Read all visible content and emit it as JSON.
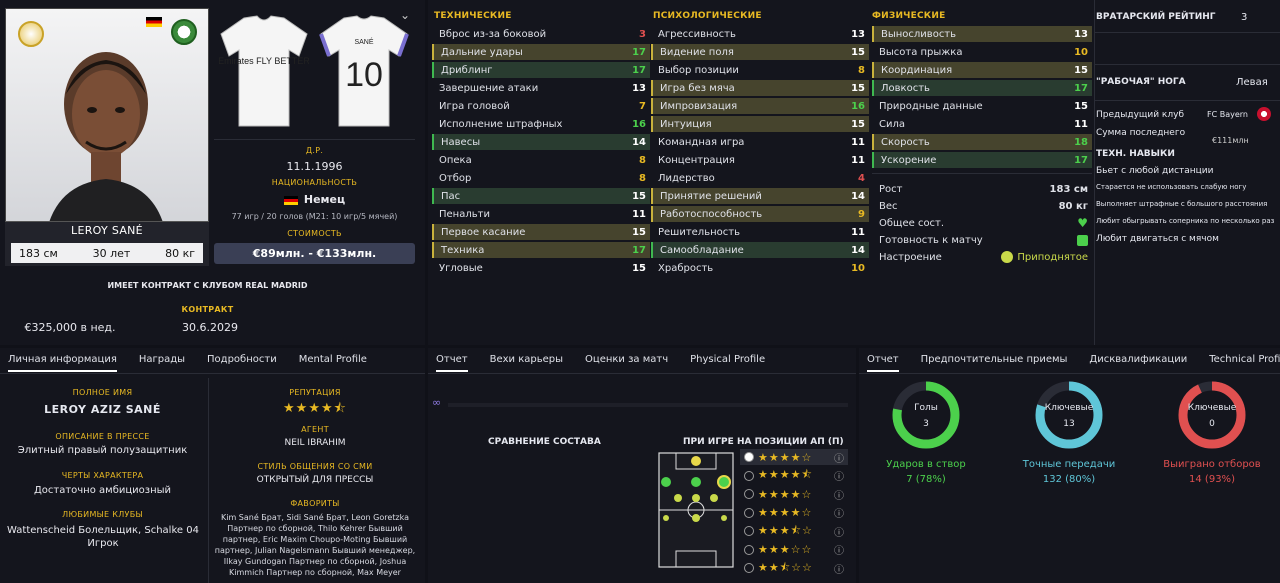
{
  "profile": {
    "name": "LEROY SANÉ",
    "height": "183 см",
    "age": "30 лет",
    "weight": "80 кг",
    "kit_back_name": "SANÉ",
    "kit_back_number": "10",
    "kit_front_text": "Emirates FLY BETTER",
    "dob_label": "Д.Р.",
    "dob": "11.1.1996",
    "nationality_label": "НАЦИОНАЛЬНОСТЬ",
    "nationality": "Немец",
    "caps": "77 игр / 20 голов (М21: 10 игр/5 мячей)",
    "value_label": "СТОИМОСТЬ",
    "value": "€89млн. - €133млн.",
    "contract_text": "ИМЕЕТ КОНТРАКТ С КЛУБОМ REAL MADRID",
    "contract_label": "КОНТРАКТ",
    "wage": "€325,000 в нед.",
    "contract_end": "30.6.2029"
  },
  "attributes": {
    "technical_title": "ТЕХНИЧЕСКИЕ",
    "mental_title": "ПСИХОЛОГИЧЕСКИЕ",
    "physical_title": "ФИЗИЧЕСКИЕ",
    "technical": [
      {
        "label": "Вброс из-за боковой",
        "value": "3",
        "hl": "",
        "color": "#e05050"
      },
      {
        "label": "Дальние удары",
        "value": "17",
        "hl": "y",
        "color": "#4cd04c"
      },
      {
        "label": "Дриблинг",
        "value": "17",
        "hl": "g",
        "color": "#4cd04c"
      },
      {
        "label": "Завершение атаки",
        "value": "13",
        "hl": "",
        "color": "#ffffff"
      },
      {
        "label": "Игра головой",
        "value": "7",
        "hl": "",
        "color": "#e8b923"
      },
      {
        "label": "Исполнение штрафных",
        "value": "16",
        "hl": "",
        "color": "#4cd04c"
      },
      {
        "label": "Навесы",
        "value": "14",
        "hl": "g",
        "color": "#ffffff"
      },
      {
        "label": "Опека",
        "value": "8",
        "hl": "",
        "color": "#e8b923"
      },
      {
        "label": "Отбор",
        "value": "8",
        "hl": "",
        "color": "#e8b923"
      },
      {
        "label": "Пас",
        "value": "15",
        "hl": "g",
        "color": "#ffffff"
      },
      {
        "label": "Пенальти",
        "value": "11",
        "hl": "",
        "color": "#ffffff"
      },
      {
        "label": "Первое касание",
        "value": "15",
        "hl": "y",
        "color": "#ffffff"
      },
      {
        "label": "Техника",
        "value": "17",
        "hl": "y",
        "color": "#4cd04c"
      },
      {
        "label": "Угловые",
        "value": "15",
        "hl": "",
        "color": "#ffffff"
      }
    ],
    "mental": [
      {
        "label": "Агрессивность",
        "value": "13",
        "hl": "",
        "color": "#ffffff"
      },
      {
        "label": "Видение поля",
        "value": "15",
        "hl": "y",
        "color": "#ffffff"
      },
      {
        "label": "Выбор позиции",
        "value": "8",
        "hl": "",
        "color": "#e8b923"
      },
      {
        "label": "Игра без мяча",
        "value": "15",
        "hl": "y",
        "color": "#ffffff"
      },
      {
        "label": "Импровизация",
        "value": "16",
        "hl": "y",
        "color": "#4cd04c"
      },
      {
        "label": "Интуиция",
        "value": "15",
        "hl": "y",
        "color": "#ffffff"
      },
      {
        "label": "Командная игра",
        "value": "11",
        "hl": "",
        "color": "#ffffff"
      },
      {
        "label": "Концентрация",
        "value": "11",
        "hl": "",
        "color": "#ffffff"
      },
      {
        "label": "Лидерство",
        "value": "4",
        "hl": "",
        "color": "#e05050"
      },
      {
        "label": "Принятие решений",
        "value": "14",
        "hl": "y",
        "color": "#ffffff"
      },
      {
        "label": "Работоспособность",
        "value": "9",
        "hl": "y",
        "color": "#e8b923"
      },
      {
        "label": "Решительность",
        "value": "11",
        "hl": "",
        "color": "#ffffff"
      },
      {
        "label": "Самообладание",
        "value": "14",
        "hl": "g",
        "color": "#ffffff"
      },
      {
        "label": "Храбрость",
        "value": "10",
        "hl": "",
        "color": "#e8b923"
      }
    ],
    "physical": [
      {
        "label": "Выносливость",
        "value": "13",
        "hl": "y",
        "color": "#ffffff"
      },
      {
        "label": "Высота прыжка",
        "value": "10",
        "hl": "",
        "color": "#e8b923"
      },
      {
        "label": "Координация",
        "value": "15",
        "hl": "y",
        "color": "#ffffff"
      },
      {
        "label": "Ловкость",
        "value": "17",
        "hl": "g",
        "color": "#4cd04c"
      },
      {
        "label": "Природные данные",
        "value": "15",
        "hl": "",
        "color": "#ffffff"
      },
      {
        "label": "Сила",
        "value": "11",
        "hl": "",
        "color": "#ffffff"
      },
      {
        "label": "Скорость",
        "value": "18",
        "hl": "y",
        "color": "#4cd04c"
      },
      {
        "label": "Ускорение",
        "value": "17",
        "hl": "g",
        "color": "#4cd04c"
      }
    ],
    "height_label": "Рост",
    "height": "183 см",
    "weight_label": "Вес",
    "weight": "80 кг",
    "condition_label": "Общее сост.",
    "match_ready_label": "Готовность к матчу",
    "morale_label": "Настроение",
    "morale": "Приподнятое"
  },
  "side": {
    "gk_label": "ВРАТАРСКИЙ РЕЙТИНГ",
    "gk_value": "3",
    "foot_label": "\"РАБОЧАЯ\" НОГА",
    "foot_value": "Левая",
    "prev_club_label": "Предыдущий клуб",
    "prev_club": "FC Bayern",
    "last_fee_label": "Сумма последнего",
    "last_fee": "€111млн",
    "traits_title": "ТЕХН. НАВЫКИ",
    "traits": [
      "Бьет с любой дистанции",
      "Старается не использовать слабую ногу",
      "Выполняет штрафные с большого расстояния",
      "Любит обыгрывать соперника по несколько раз",
      "Любит двигаться с мячом"
    ]
  },
  "info": {
    "tabs": [
      "Личная информация",
      "Награды",
      "Подробности",
      "Mental Profile"
    ],
    "full_name_label": "ПОЛНОЕ ИМЯ",
    "full_name": "LEROY AZIZ SANÉ",
    "press_label": "ОПИСАНИЕ В ПРЕССЕ",
    "press": "Элитный правый полузащитник",
    "character_label": "ЧЕРТЫ ХАРАКТЕРА",
    "character": "Достаточно амбициозный",
    "fav_clubs_label": "ЛЮБИМЫЕ КЛУБЫ",
    "fav_clubs": "Wattenscheid Болельщик, Schalke 04 Игрок",
    "reputation_label": "РЕПУТАЦИЯ",
    "reputation_stars": 4.5,
    "agent_label": "АГЕНТ",
    "agent": "NEIL IBRAHIM",
    "media_label": "СТИЛЬ ОБЩЕНИЯ СО СМИ",
    "media": "ОТКРЫТЫЙ ДЛЯ ПРЕССЫ",
    "favourites_label": "ФАВОРИТЫ",
    "favourites": "Kim Sané Брат, Sidi Sané Брат, Leon Goretzka Партнер по сборной, Thilo Kehrer Бывший партнер, Eric Maxim Choupo-Moting Бывший партнер, Julian Nagelsmann Бывший менеджер, Ilkay Gundogan Партнер по сборной, Joshua Kimmich Партнер по сборной, Max Meyer"
  },
  "compare": {
    "tabs": [
      "Отчет",
      "Вехи карьеры",
      "Оценки за матч",
      "Physical Profile"
    ],
    "squad_compare": "СРАВНЕНИЕ СОСТАВА",
    "position_title": "ПРИ ИГРЕ НА ПОЗИЦИИ АП (П)",
    "star_rows": [
      4,
      4.5,
      4,
      4,
      3.5,
      3,
      2.5
    ]
  },
  "report": {
    "tabs": [
      "Отчет",
      "Предпочтительные приемы",
      "Дисквалификации",
      "Technical Profile"
    ],
    "rings": [
      {
        "title": "Голы",
        "value": "3",
        "caption": "Ударов в створ",
        "stat": "7 (78%)",
        "color": "#4cd04c",
        "frac": 0.78
      },
      {
        "title": "Ключевые",
        "value": "13",
        "caption": "Точные передачи",
        "stat": "132 (80%)",
        "color": "#5fc6d8",
        "frac": 0.8
      },
      {
        "title": "Ключевые",
        "value": "0",
        "caption": "Выиграно отборов",
        "stat": "14 (93%)",
        "color": "#e05050",
        "frac": 0.93
      }
    ]
  }
}
